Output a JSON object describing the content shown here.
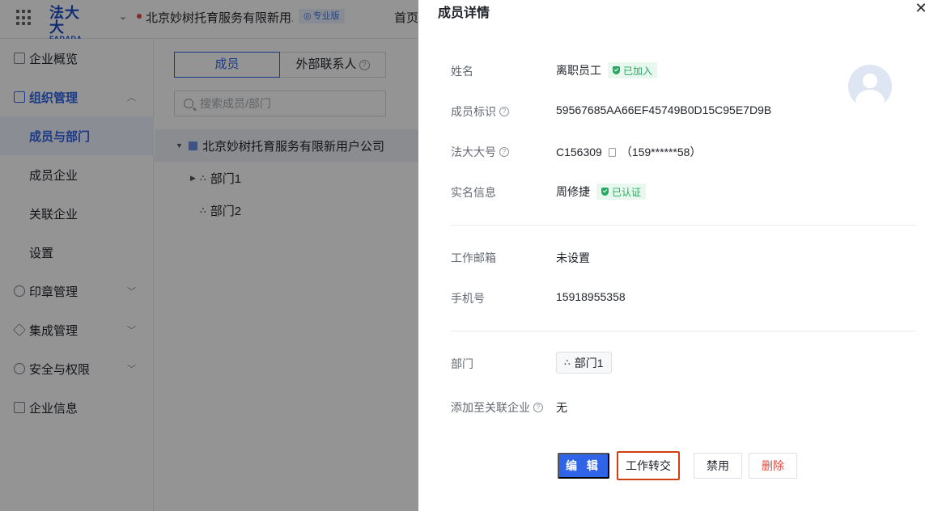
{
  "topbar": {
    "logo_cn": "法大大",
    "logo_en": "FADADA",
    "org_name": "北京妙树托育服务有限新用...",
    "edition_badge": "专业版",
    "home_link": "首页"
  },
  "sidebar": {
    "items": [
      {
        "label": "企业概览"
      },
      {
        "label": "组织管理"
      },
      {
        "label": "成员与部门"
      },
      {
        "label": "成员企业"
      },
      {
        "label": "关联企业"
      },
      {
        "label": "设置"
      },
      {
        "label": "印章管理"
      },
      {
        "label": "集成管理"
      },
      {
        "label": "安全与权限"
      },
      {
        "label": "企业信息"
      }
    ]
  },
  "content": {
    "tab_members": "成员",
    "tab_external": "外部联系人",
    "search_placeholder": "搜索成员/部门",
    "tree_root": "北京妙树托育服务有限新用户公司",
    "tree_children": [
      "部门1",
      "部门2"
    ]
  },
  "drawer": {
    "title": "成员详情",
    "close_icon": "✕",
    "fields": {
      "name_label": "姓名",
      "name_value": "离职员工",
      "joined_tag": "已加入",
      "member_id_label": "成员标识",
      "member_id_value": "59567685AA66EF45749B0D15C95E7D9B",
      "fdd_label": "法大大号",
      "fdd_value": "C156309",
      "fdd_phone": "（159******58）",
      "realname_label": "实名信息",
      "realname_value": "周修捷",
      "verified_tag": "已认证",
      "email_label": "工作邮箱",
      "email_value": "未设置",
      "phone_label": "手机号",
      "phone_value": "15918955358",
      "dept_label": "部门",
      "dept_value": "部门1",
      "linked_label": "添加至关联企业",
      "linked_value": "无"
    },
    "buttons": {
      "edit": "编 辑",
      "transfer": "工作转交",
      "disable": "禁用",
      "delete": "删除"
    }
  }
}
